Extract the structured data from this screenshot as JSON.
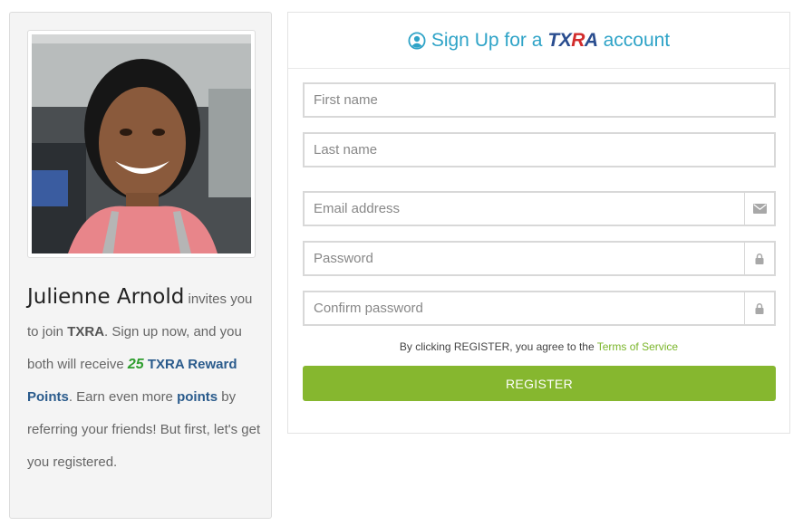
{
  "invite": {
    "inviter_name": "Julienne Arnold",
    "text_invites": " invites you to join ",
    "brand": "TXRA",
    "text_signup": ".  Sign up now, and you both will receive ",
    "points_amount": "25",
    "points_label": "TXRA Reward Points",
    "text_earn": ".  Earn even more ",
    "points_word": "points",
    "text_tail": " by referring your friends! But first, let's get you registered."
  },
  "signup": {
    "title_prefix": "Sign Up for a",
    "logo_tx": "TX",
    "logo_r": "R",
    "logo_a": "A",
    "title_suffix": "account",
    "fields": {
      "first_name": {
        "placeholder": "First name",
        "value": ""
      },
      "last_name": {
        "placeholder": "Last name",
        "value": ""
      },
      "email": {
        "placeholder": "Email address",
        "value": ""
      },
      "password": {
        "placeholder": "Password",
        "value": ""
      },
      "confirm_password": {
        "placeholder": "Confirm password",
        "value": ""
      }
    },
    "terms_prefix": "By clicking REGISTER, you agree to the ",
    "terms_link": "Terms of Service",
    "register_label": "REGISTER"
  },
  "icons": {
    "title_icon": "user-circle-icon",
    "email_icon": "envelope-icon",
    "password_icon": "lock-icon",
    "confirm_icon": "lock-icon"
  },
  "colors": {
    "accent_blue": "#2ea3c7",
    "register_green": "#86b72f",
    "link_green": "#7ab52a",
    "logo_navy": "#2a4d8f",
    "logo_red": "#d22c2c",
    "points_green": "#2f9e2f"
  }
}
